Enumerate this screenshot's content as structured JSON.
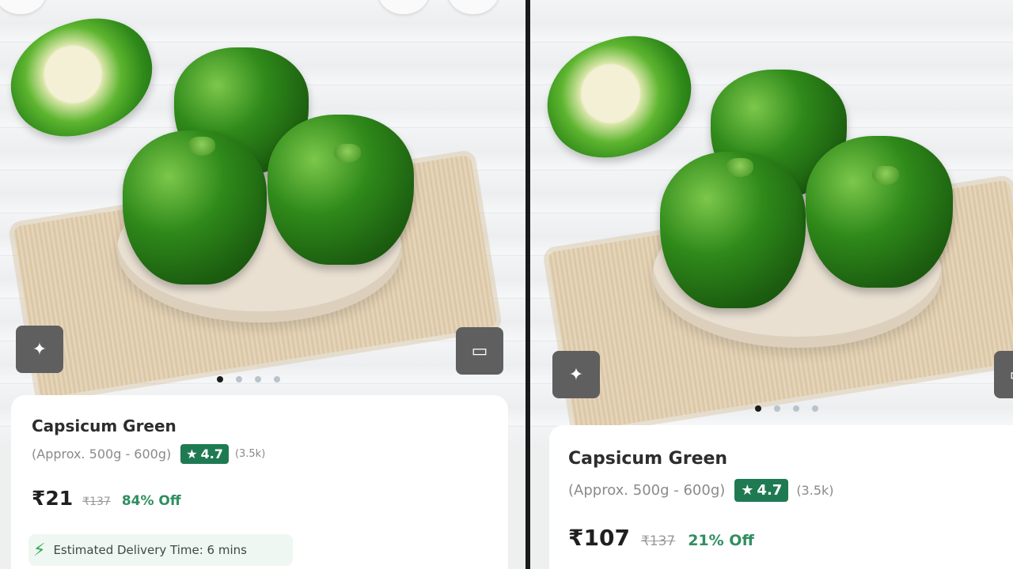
{
  "product": {
    "name": "Capsicum Green",
    "quantity": "(Approx. 500g - 600g)",
    "rating": "4.7",
    "rating_count": "(3.5k)",
    "mrp": "₹137"
  },
  "left_panel": {
    "price": "₹21",
    "discount": "84% Off",
    "delivery_text": "Estimated Delivery Time: 6 mins"
  },
  "right_panel": {
    "price": "₹107",
    "discount": "21% Off"
  },
  "icons": {
    "sparkle": "✦",
    "star": "★",
    "bolt": "⚡",
    "gallery": "▭"
  },
  "colors": {
    "rating_badge": "#1f7a52",
    "discount_text": "#2f8f60",
    "delivery_bg": "#eef7f1"
  },
  "carousel": {
    "total": 4,
    "active": 1
  }
}
